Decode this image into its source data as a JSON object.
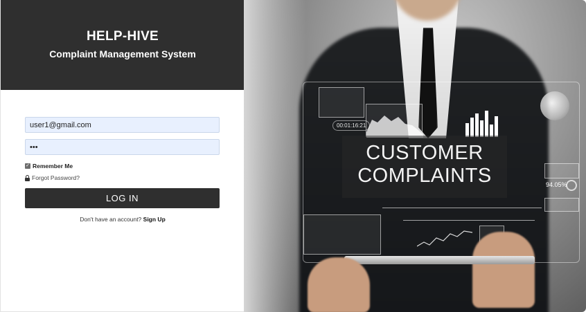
{
  "header": {
    "brand": "HELP-HIVE",
    "subtitle": "Complaint Management System"
  },
  "form": {
    "email_value": "user1@gmail.com",
    "password_value": "•••",
    "remember_label": "Remember Me",
    "remember_checked": true,
    "forgot_label": "Forgot Password?",
    "login_label": "LOG IN",
    "signup_prompt": "Don't have an account?",
    "signup_link": "Sign Up"
  },
  "hero": {
    "title_line1": "CUSTOMER",
    "title_line2": "COMPLAINTS",
    "timer": "00:01:16:21",
    "percent": "94.05%"
  },
  "colors": {
    "header_bg": "#2f2f2f",
    "button_bg": "#2f2f2f",
    "input_bg": "#e8f0fe"
  }
}
